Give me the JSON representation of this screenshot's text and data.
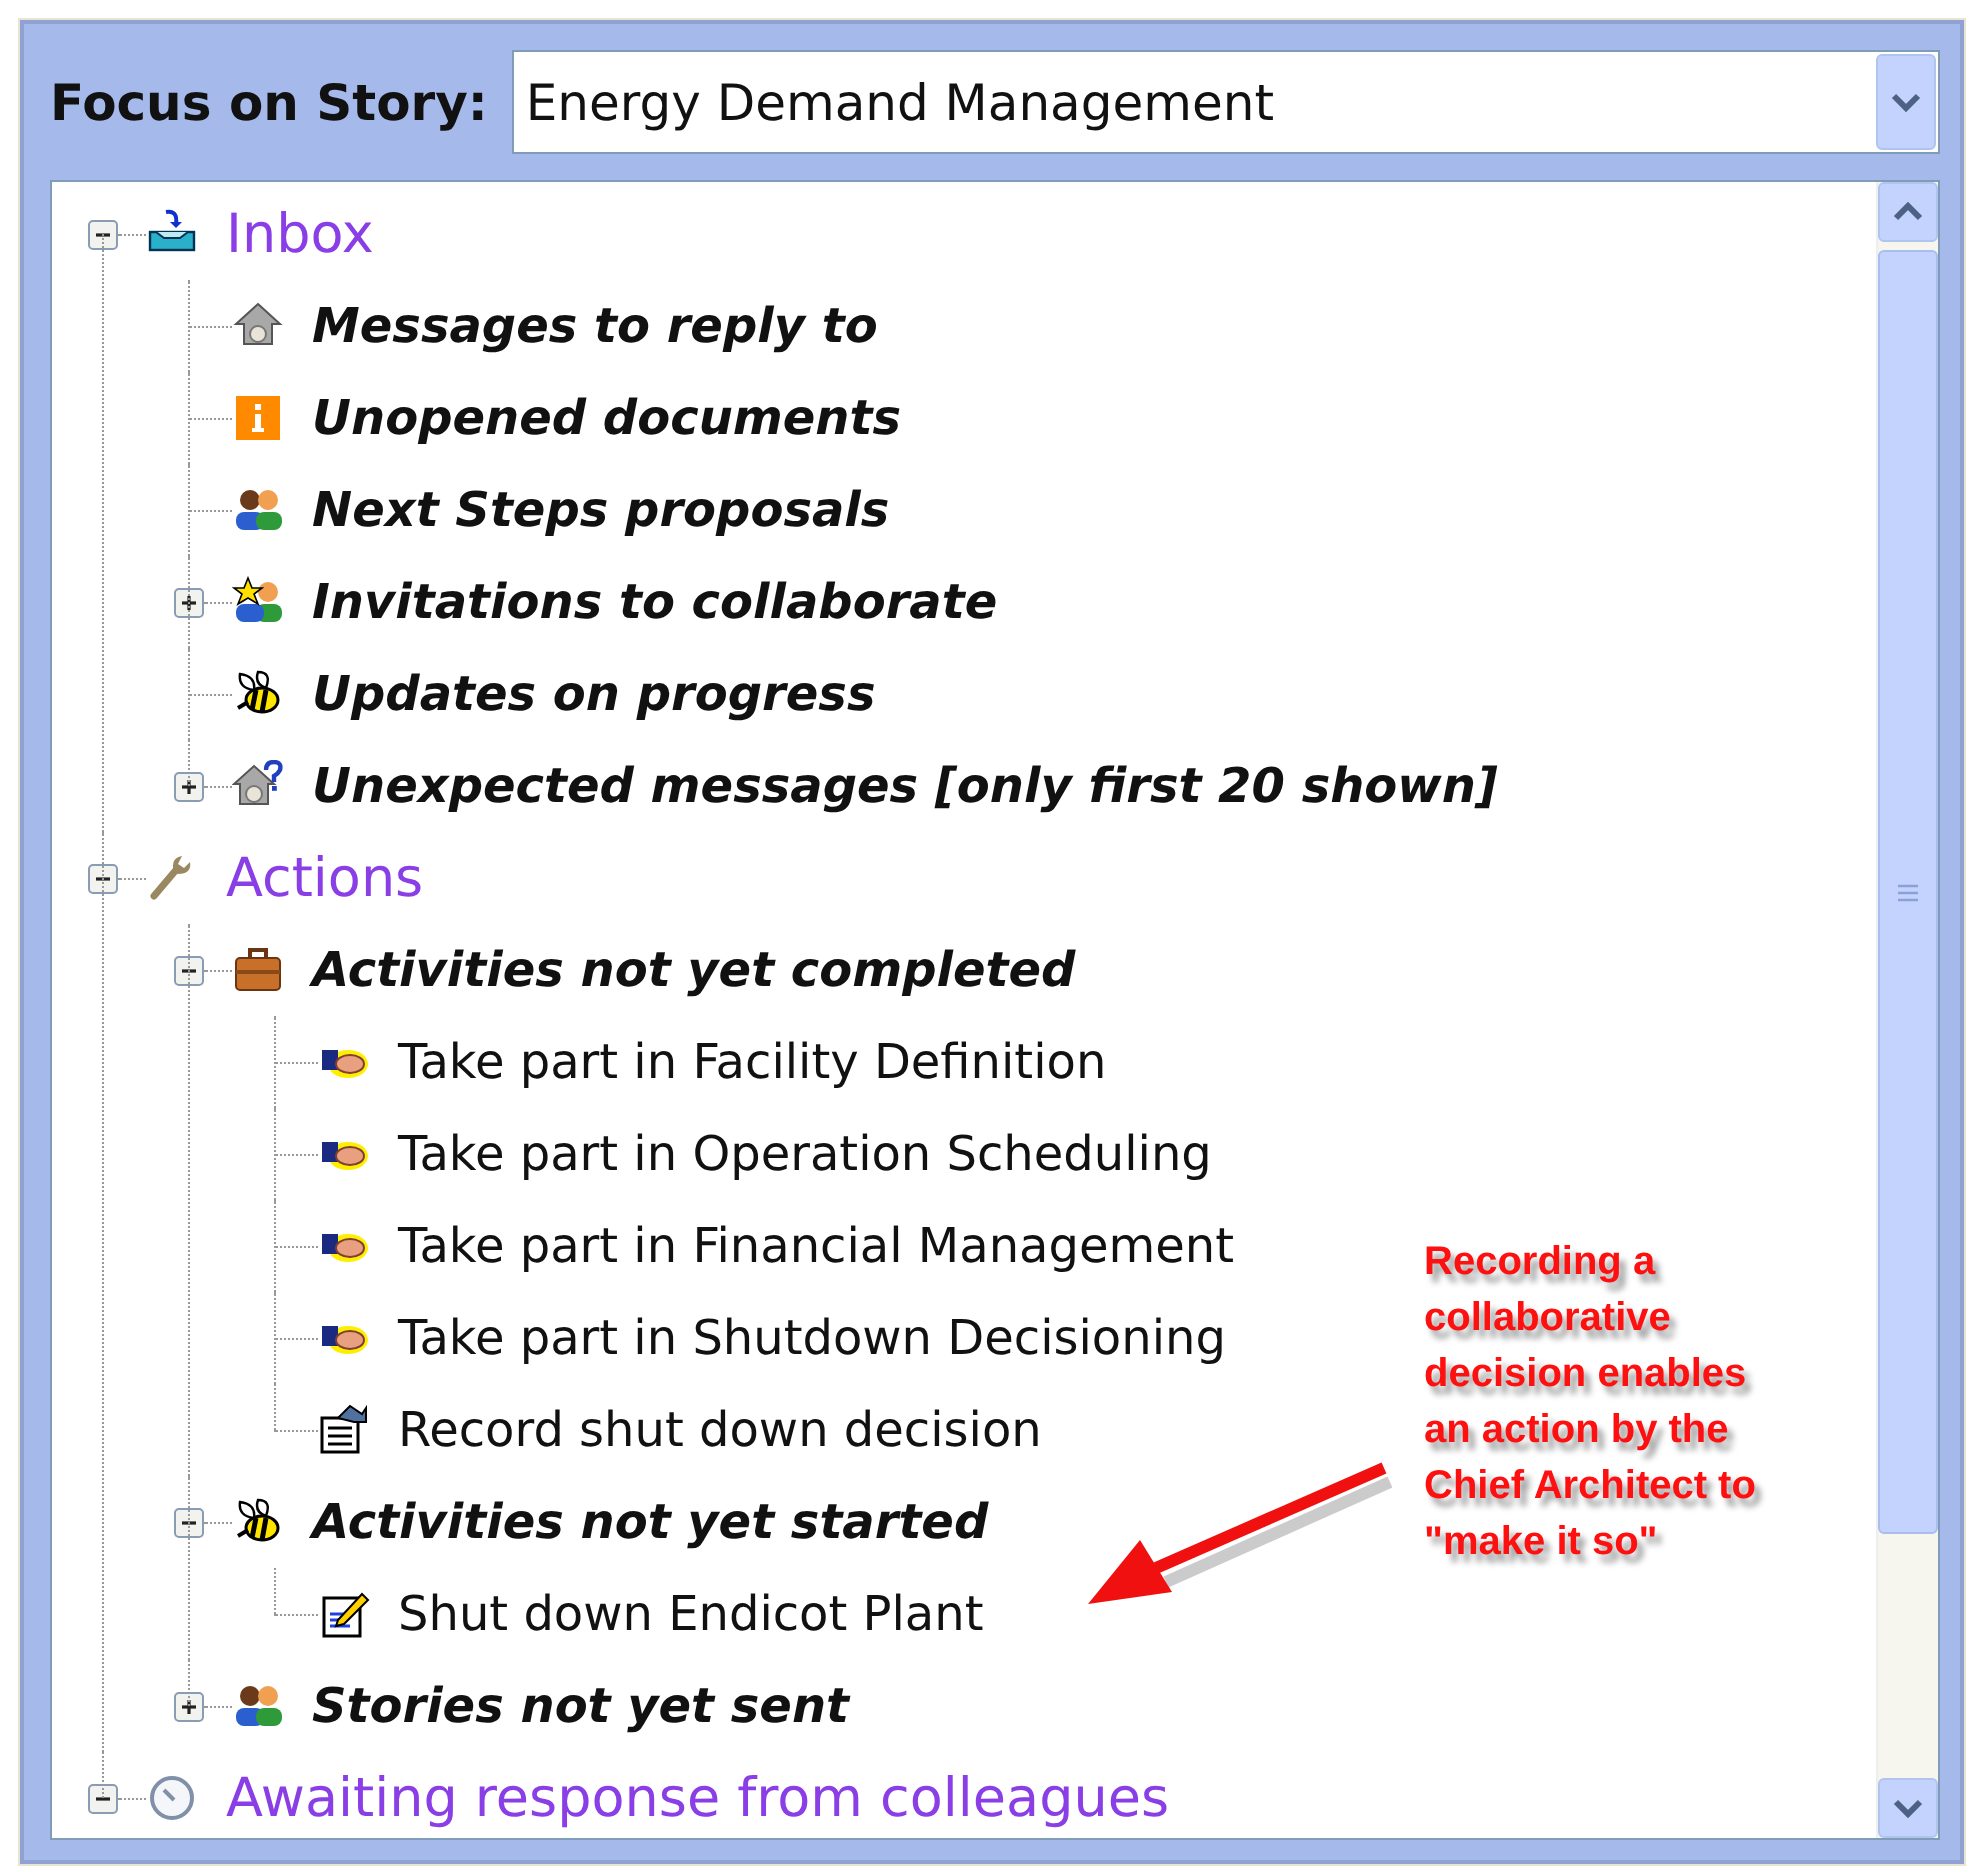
{
  "header": {
    "label": "Focus on Story:",
    "story": "Energy Demand Management"
  },
  "tree": [
    {
      "label": "Inbox",
      "kind": "category",
      "expanded": true,
      "children": [
        {
          "label": "Messages to reply to",
          "kind": "folder"
        },
        {
          "label": "Unopened documents",
          "kind": "folder"
        },
        {
          "label": "Next Steps proposals",
          "kind": "folder"
        },
        {
          "label": "Invitations to collaborate",
          "kind": "folder",
          "expanded": false
        },
        {
          "label": "Updates on progress",
          "kind": "folder"
        },
        {
          "label": "Unexpected messages [only first 20 shown]",
          "kind": "folder",
          "expanded": false
        }
      ]
    },
    {
      "label": "Actions",
      "kind": "category",
      "expanded": true,
      "children": [
        {
          "label": "Activities not yet completed",
          "kind": "folder",
          "expanded": true,
          "children": [
            {
              "label": "Take part in Facility Definition",
              "kind": "task"
            },
            {
              "label": "Take part in Operation Scheduling",
              "kind": "task"
            },
            {
              "label": "Take part in Financial Management",
              "kind": "task"
            },
            {
              "label": "Take part in Shutdown Decisioning",
              "kind": "task"
            },
            {
              "label": "Record shut down decision",
              "kind": "task"
            }
          ]
        },
        {
          "label": "Activities not yet started",
          "kind": "folder",
          "expanded": true,
          "children": [
            {
              "label": "Shut down Endicot Plant",
              "kind": "task"
            }
          ]
        },
        {
          "label": "Stories not yet sent",
          "kind": "folder",
          "expanded": false
        }
      ]
    },
    {
      "label": "Awaiting response from colleagues",
      "kind": "category",
      "expanded": true
    }
  ],
  "callout": {
    "text": "Recording a\ncollaborative\ndecision enables\nan action by the\nChief Architect to\n\"make it so\""
  }
}
